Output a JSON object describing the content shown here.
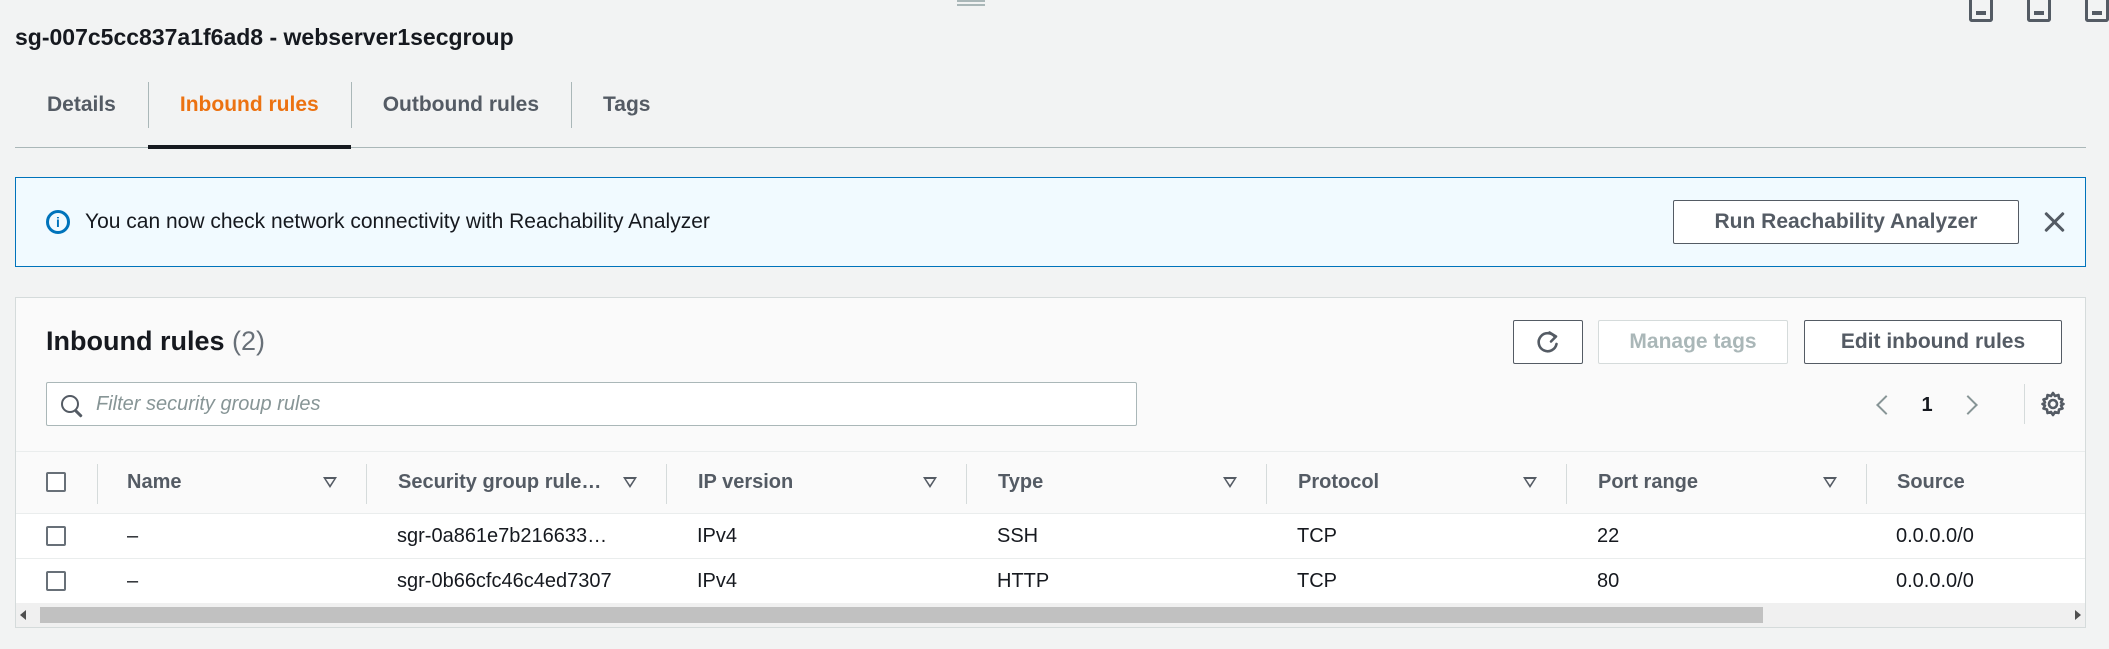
{
  "page": {
    "title": "sg-007c5cc837a1f6ad8 - webserver1secgroup"
  },
  "tabs": [
    {
      "label": "Details",
      "active": false
    },
    {
      "label": "Inbound rules",
      "active": true
    },
    {
      "label": "Outbound rules",
      "active": false
    },
    {
      "label": "Tags",
      "active": false
    }
  ],
  "banner": {
    "icon": "info-icon",
    "text": "You can now check network connectivity with Reachability Analyzer",
    "button_label": "Run Reachability Analyzer",
    "close_icon": "close-icon"
  },
  "table": {
    "title": "Inbound rules",
    "count": "(2)",
    "refresh_icon": "refresh-icon",
    "manage_tags_label": "Manage tags",
    "edit_label": "Edit inbound rules",
    "search_placeholder": "Filter security group rules",
    "pagination": {
      "current_page": "1"
    },
    "columns": [
      "Name",
      "Security group rule…",
      "IP version",
      "Type",
      "Protocol",
      "Port range",
      "Source"
    ],
    "rows": [
      {
        "name": "–",
        "rule_id": "sgr-0a861e7b216633…",
        "ip_version": "IPv4",
        "type": "SSH",
        "protocol": "TCP",
        "port_range": "22",
        "source": "0.0.0.0/0"
      },
      {
        "name": "–",
        "rule_id": "sgr-0b66cfc46c4ed7307",
        "ip_version": "IPv4",
        "type": "HTTP",
        "protocol": "TCP",
        "port_range": "80",
        "source": "0.0.0.0/0"
      }
    ]
  },
  "colors": {
    "accent_active_tab": "#ec7211",
    "info_blue": "#0073bb",
    "banner_bg": "#f1faff",
    "text_primary": "#16191f",
    "text_secondary": "#545b64"
  }
}
